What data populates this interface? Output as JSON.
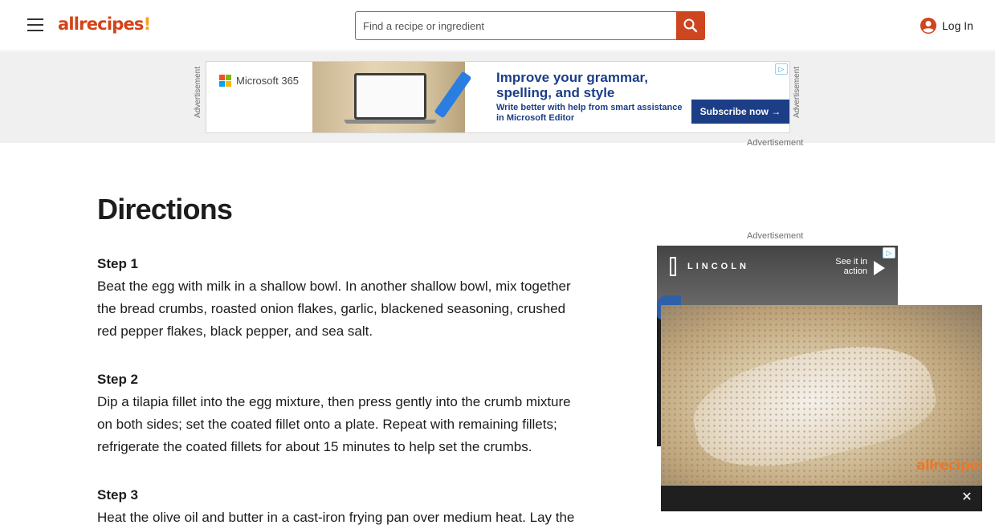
{
  "header": {
    "logo_text": "allrecipes",
    "logo_bang": "!",
    "search_placeholder": "Find a recipe or ingredient",
    "login_label": "Log In",
    "brand_color": "#ce4620"
  },
  "top_ad": {
    "side_label_left": "Advertisement",
    "side_label_right": "Advertisement",
    "brand": "Microsoft 365",
    "headline": "Improve your grammar, spelling, and style",
    "subline": "Write better with help from smart assistance in Microsoft Editor",
    "cta": "Subscribe now →",
    "caption_below": "Advertisement"
  },
  "directions": {
    "title": "Directions",
    "steps": [
      {
        "label": "Step 1",
        "text": "Beat the egg with milk in a shallow bowl. In another shallow bowl, mix together the bread crumbs, roasted onion flakes, garlic, blackened seasoning, crushed red pepper flakes, black pepper, and sea salt."
      },
      {
        "label": "Step 2",
        "text": "Dip a tilapia fillet into the egg mixture, then press gently into the crumb mixture on both sides; set the coated fillet onto a plate. Repeat with remaining fillets; refrigerate the coated fillets for about 15 minutes to help set the crumbs."
      },
      {
        "label": "Step 3",
        "text": "Heat the olive oil and butter in a cast-iron frying pan over medium heat. Lay the"
      }
    ]
  },
  "side_ad": {
    "caption": "Advertisement",
    "brand": "LINCOLN",
    "cta": "See it in action"
  },
  "video": {
    "logo_text": "allrecipes",
    "close_label": "✕"
  }
}
